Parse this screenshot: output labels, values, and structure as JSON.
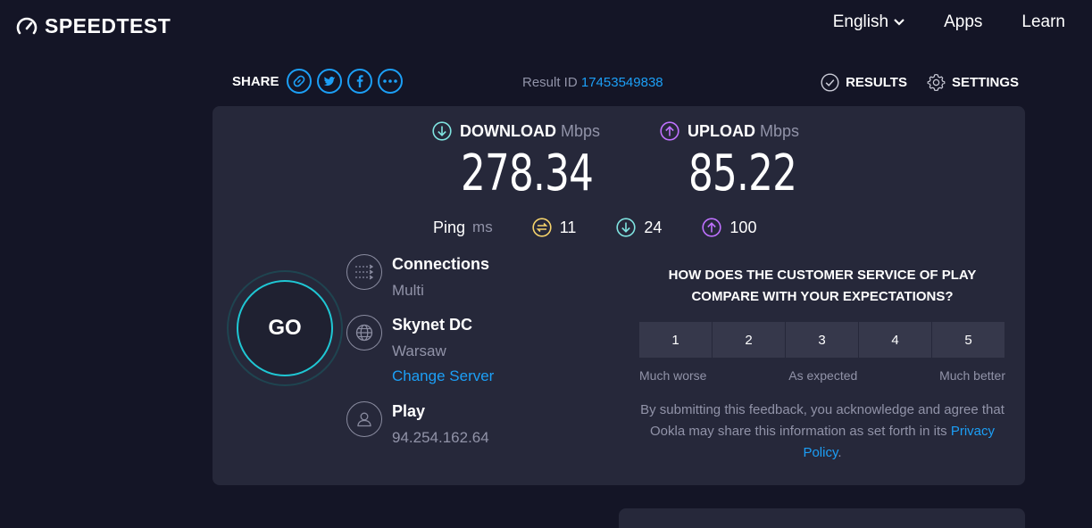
{
  "header": {
    "logo_text": "SPEEDTEST",
    "nav": [
      {
        "label": "English"
      },
      {
        "label": "Apps"
      },
      {
        "label": "Learn"
      }
    ]
  },
  "share": {
    "label": "SHARE",
    "buttons": [
      "link-icon",
      "twitter-icon",
      "facebook-icon",
      "more-icon"
    ]
  },
  "result": {
    "label": "Result ID",
    "id": "17453549838"
  },
  "tools": {
    "results_label": "RESULTS",
    "settings_label": "SETTINGS"
  },
  "download": {
    "label": "DOWNLOAD",
    "unit": "Mbps",
    "value": "278.34"
  },
  "upload": {
    "label": "UPLOAD",
    "unit": "Mbps",
    "value": "85.22"
  },
  "ping": {
    "label": "Ping",
    "unit": "ms",
    "idle": "11",
    "download": "24",
    "upload": "100"
  },
  "go": {
    "label": "GO"
  },
  "connections": {
    "title": "Connections",
    "value": "Multi"
  },
  "server": {
    "title": "Skynet DC",
    "location": "Warsaw",
    "change_label": "Change Server"
  },
  "provider": {
    "title": "Play",
    "ip": "94.254.162.64"
  },
  "survey": {
    "question": "HOW DOES THE CUSTOMER SERVICE OF PLAY COMPARE WITH YOUR EXPECTATIONS?",
    "ratings": [
      "1",
      "2",
      "3",
      "4",
      "5"
    ],
    "scale_low": "Much worse",
    "scale_mid": "As expected",
    "scale_high": "Much better",
    "disclaimer": "By submitting this feedback, you acknowledge and agree that Ookla may share this information as set forth in its ",
    "policy_link": "Privacy Policy",
    "disclaimer_end": "."
  },
  "colors": {
    "background": "#141526",
    "card": "#26283a",
    "accent_blue": "#1c9ff6",
    "download": "#7fe3e0",
    "upload": "#bf71ff",
    "ping_idle": "#f5d36b",
    "go_ring": "#1fc7d4"
  }
}
